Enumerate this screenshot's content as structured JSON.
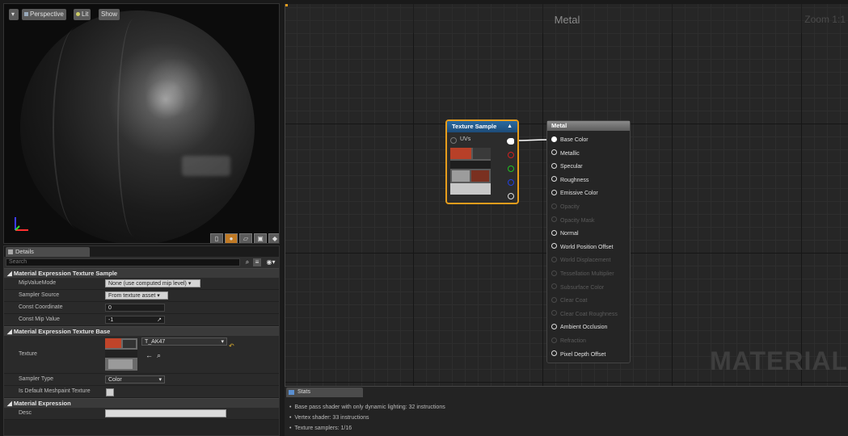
{
  "viewport": {
    "buttons": {
      "menu": "▾",
      "perspective": "Perspective",
      "lit": "Lit",
      "show": "Show"
    },
    "toolbar_icons": [
      "cylinder-icon",
      "sphere-icon",
      "plane-icon",
      "cube-icon",
      "teapot-icon"
    ]
  },
  "details": {
    "tab_label": "Details",
    "search_placeholder": "Search",
    "sections": {
      "texture_sample": {
        "header": "Material Expression Texture Sample",
        "mip_value_mode_label": "MipValueMode",
        "mip_value_mode_value": "None (use computed mip level) ▾",
        "sampler_source_label": "Sampler Source",
        "sampler_source_value": "From texture asset ▾",
        "const_coordinate_label": "Const Coordinate",
        "const_coordinate_value": "0",
        "const_mip_value_label": "Const Mip Value",
        "const_mip_value_value": "-1"
      },
      "texture_base": {
        "header": "Material Expression Texture Base",
        "texture_label": "Texture",
        "texture_value": "T_AK47",
        "sampler_type_label": "Sampler Type",
        "sampler_type_value": "Color",
        "default_meshpaint_label": "Is Default Meshpaint Texture"
      },
      "expression": {
        "header": "Material Expression",
        "desc_label": "Desc"
      }
    }
  },
  "graph": {
    "title": "Metal",
    "zoom": "Zoom 1:1",
    "watermark": "MATERIAL",
    "texture_node": {
      "title": "Texture Sample",
      "uvs_label": "UVs"
    },
    "metal_node": {
      "title": "Metal",
      "pins": [
        {
          "label": "Base Color",
          "enabled": true
        },
        {
          "label": "Metallic",
          "enabled": true
        },
        {
          "label": "Specular",
          "enabled": true
        },
        {
          "label": "Roughness",
          "enabled": true
        },
        {
          "label": "Emissive Color",
          "enabled": true
        },
        {
          "label": "Opacity",
          "enabled": false
        },
        {
          "label": "Opacity Mask",
          "enabled": false
        },
        {
          "label": "Normal",
          "enabled": true
        },
        {
          "label": "World Position Offset",
          "enabled": true
        },
        {
          "label": "World Displacement",
          "enabled": false
        },
        {
          "label": "Tessellation Multiplier",
          "enabled": false
        },
        {
          "label": "Subsurface Color",
          "enabled": false
        },
        {
          "label": "Clear Coat",
          "enabled": false
        },
        {
          "label": "Clear Coat Roughness",
          "enabled": false
        },
        {
          "label": "Ambient Occlusion",
          "enabled": true
        },
        {
          "label": "Refraction",
          "enabled": false
        },
        {
          "label": "Pixel Depth Offset",
          "enabled": true
        }
      ]
    }
  },
  "stats": {
    "tab_label": "Stats",
    "lines": [
      "Base pass shader with only dynamic lighting: 32 instructions",
      "Vertex shader: 33 instructions",
      "Texture samplers: 1/16"
    ]
  },
  "colors": {
    "selection_orange": "#e79d1c",
    "texture_header_blue": "#2a6aa0",
    "pin_red": "#d02020",
    "pin_green": "#20c020",
    "pin_blue": "#2040e0"
  }
}
